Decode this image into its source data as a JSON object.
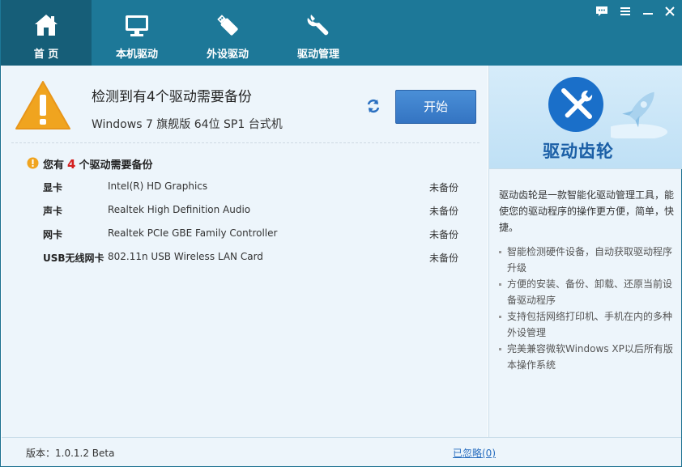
{
  "nav": {
    "tabs": [
      {
        "label": "首 页",
        "icon": "home-icon",
        "active": true
      },
      {
        "label": "本机驱动",
        "icon": "monitor-icon",
        "active": false
      },
      {
        "label": "外设驱动",
        "icon": "usb-drive-icon",
        "active": false
      },
      {
        "label": "驱动管理",
        "icon": "wrench-icon",
        "active": false
      }
    ]
  },
  "window_controls": [
    "feedback-icon",
    "menu-icon",
    "minimize-icon",
    "close-icon"
  ],
  "status": {
    "headline": "检测到有4个驱动需要备份",
    "os_info": "Windows 7 旗舰版  64位 SP1 台式机",
    "start_button": "开始"
  },
  "summary": {
    "prefix": "您有",
    "count": "4",
    "suffix": "个驱动需要备份"
  },
  "drivers": [
    {
      "category": "显卡",
      "name": "Intel(R) HD Graphics",
      "status": "未备份"
    },
    {
      "category": "声卡",
      "name": "Realtek High Definition Audio",
      "status": "未备份"
    },
    {
      "category": "网卡",
      "name": "Realtek PCIe GBE Family Controller",
      "status": "未备份"
    },
    {
      "category": "USB无线网卡",
      "name": "802.11n USB Wireless LAN Card",
      "status": "未备份"
    }
  ],
  "promo": {
    "brand": "驱动齿轮",
    "description": "驱动齿轮是一款智能化驱动管理工具，能使您的驱动程序的操作更方便，简单，快捷。",
    "features": [
      "智能检测硬件设备，自动获取驱动程序升级",
      "方便的安装、备份、卸载、还原当前设备驱动程序",
      "支持包括网络打印机、手机在内的多种外设管理",
      "完美兼容微软Windows XP以后所有版本操作系统"
    ]
  },
  "footer": {
    "version": "版本：1.0.1.2 Beta",
    "ignored": "已忽略(0)"
  },
  "colors": {
    "titlebar": "#1d7898",
    "active_tab": "#165e78",
    "start_button": "#3a7fcb",
    "warning": "#f0a41f",
    "count_red": "#d42020",
    "brand_blue": "#1b5fa6"
  }
}
